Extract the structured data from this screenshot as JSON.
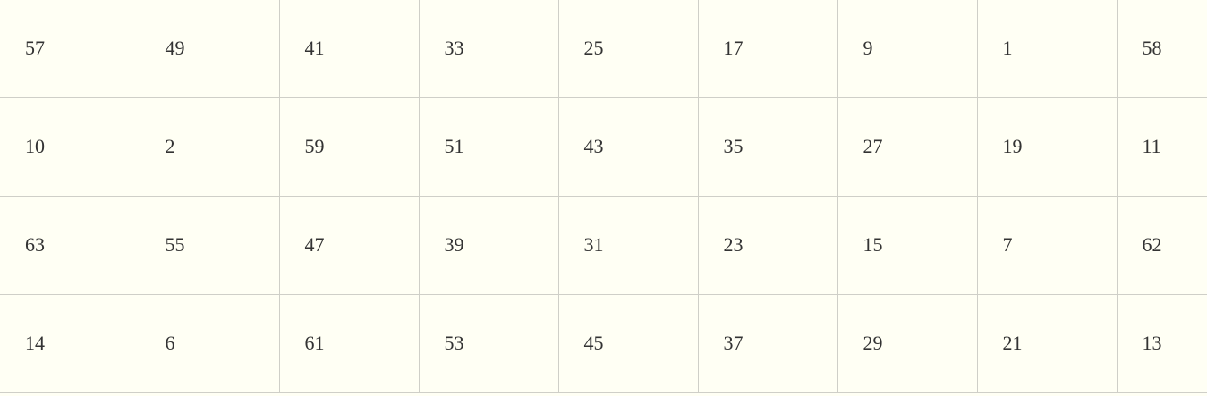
{
  "table": {
    "rows": [
      [
        "57",
        "49",
        "41",
        "33",
        "25",
        "17",
        "9",
        "1",
        "58"
      ],
      [
        "10",
        "2",
        "59",
        "51",
        "43",
        "35",
        "27",
        "19",
        "11"
      ],
      [
        "63",
        "55",
        "47",
        "39",
        "31",
        "23",
        "15",
        "7",
        "62"
      ],
      [
        "14",
        "6",
        "61",
        "53",
        "45",
        "37",
        "29",
        "21",
        "13"
      ]
    ]
  },
  "colors": {
    "background": "#fffff4",
    "grid_line": "#cfcfc8",
    "text": "#333333"
  }
}
